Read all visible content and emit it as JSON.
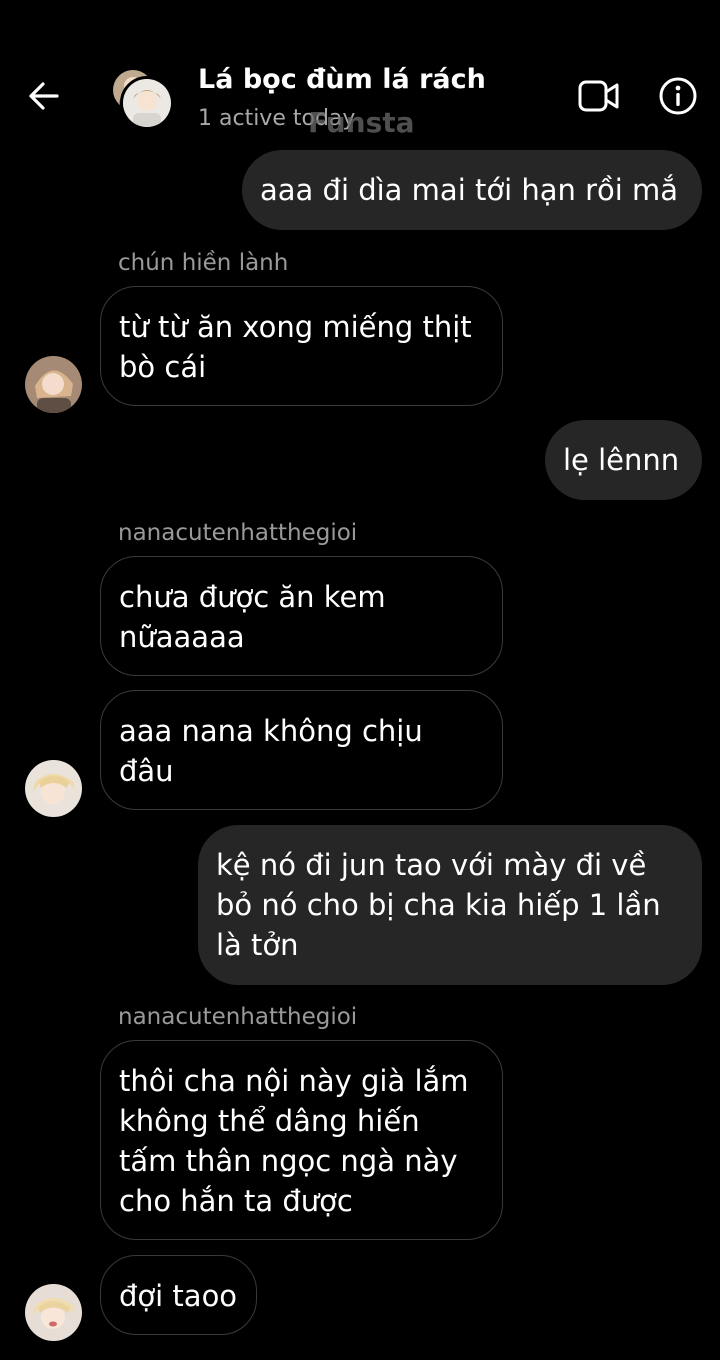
{
  "header": {
    "back_icon": "arrow-left-icon",
    "title": "Lá bọc đùm lá rách",
    "status": "1 active today",
    "watermark": "Funsta",
    "video_icon": "video-camera-icon",
    "info_icon": "info-icon"
  },
  "messages": [
    {
      "direction": "out",
      "text": "aaa đi dìa mai tới hạn rồi mắ"
    },
    {
      "direction": "in",
      "sender": "chún hiền lành",
      "text": "từ từ ăn xong miếng thịt\nbò cái"
    },
    {
      "direction": "out",
      "text": "lẹ lênnn"
    },
    {
      "direction": "in",
      "sender": "nanacutenhatthegioi",
      "text": "chưa được ăn kem\nnữaaaaa"
    },
    {
      "direction": "in",
      "text": "aaa nana không chịu\nđâu"
    },
    {
      "direction": "out",
      "text": "kệ nó đi jun tao với mày đi về\nbỏ nó cho bị cha kia hiếp 1 lần\nlà tởn"
    },
    {
      "direction": "in",
      "sender": "nanacutenhatthegioi",
      "text": "thôi cha nội này già lắm\nkhông thể dâng hiến\ntấm thân ngọc ngà này\ncho hắn ta được"
    },
    {
      "direction": "in",
      "text": "đợi taoo"
    }
  ],
  "colors": {
    "background": "#000000",
    "outgoing_bubble": "#262626",
    "incoming_border": "#3a3a3a",
    "secondary_text": "#9a9a9a"
  }
}
